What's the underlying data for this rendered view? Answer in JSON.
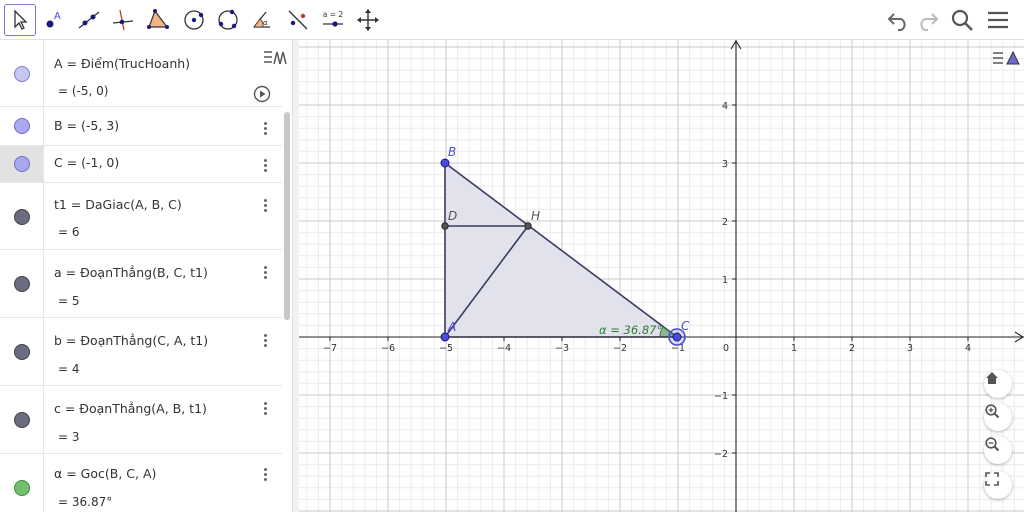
{
  "toolbar": {
    "tools": [
      "move-tool",
      "point-tool",
      "line-tool",
      "perpendicular-line-tool",
      "polygon-tool",
      "circle-center-point-tool",
      "circle-three-points-tool",
      "angle-tool",
      "reflect-tool",
      "slider-tool",
      "move-graphics-view-tool"
    ],
    "slider_label": "a = 2",
    "right": [
      "undo",
      "redo",
      "search",
      "menu"
    ]
  },
  "algebra": {
    "rows": [
      {
        "definition": "A = Điểm(TrucHoanh)",
        "value": "= (-5, 0)",
        "color": "#c6c6f5"
      },
      {
        "definition": "B = (-5, 3)",
        "value": "",
        "color": "#a9a9f0"
      },
      {
        "definition": "C = (-1, 0)",
        "value": "",
        "color": "#a9a9f0"
      },
      {
        "definition": "t1 = DaGiac(A, B, C)",
        "value": "= 6",
        "color": "#6c6c80"
      },
      {
        "definition": "a = ĐoạnThẳng(B, C, t1)",
        "value": "= 5",
        "color": "#6c6c80"
      },
      {
        "definition": "b = ĐoạnThẳng(C, A, t1)",
        "value": "= 4",
        "color": "#6c6c80"
      },
      {
        "definition": "c = ĐoạnThẳng(A, B, t1)",
        "value": "= 3",
        "color": "#6c6c80"
      },
      {
        "definition": "α = Goc(B, C, A)",
        "value": "= 36.87°",
        "color": "#6fbf6f"
      }
    ]
  },
  "graphics": {
    "x_ticks": [
      "−7",
      "−6",
      "−5",
      "−4",
      "−3",
      "−2",
      "−1",
      "0",
      "1",
      "2",
      "3",
      "4"
    ],
    "y_ticks": [
      "4",
      "3",
      "2",
      "1",
      "−1",
      "−2"
    ],
    "point_labels": {
      "A": "A",
      "B": "B",
      "C": "C",
      "D": "D",
      "H": "H"
    },
    "angle_label": "α = 36.87°",
    "colors": {
      "axis": "#222222",
      "polygon_fill": "#e2e2ec",
      "polygon_stroke": "#3c3c60",
      "point": "#4a4adc",
      "angle": "#2e7d32"
    }
  }
}
